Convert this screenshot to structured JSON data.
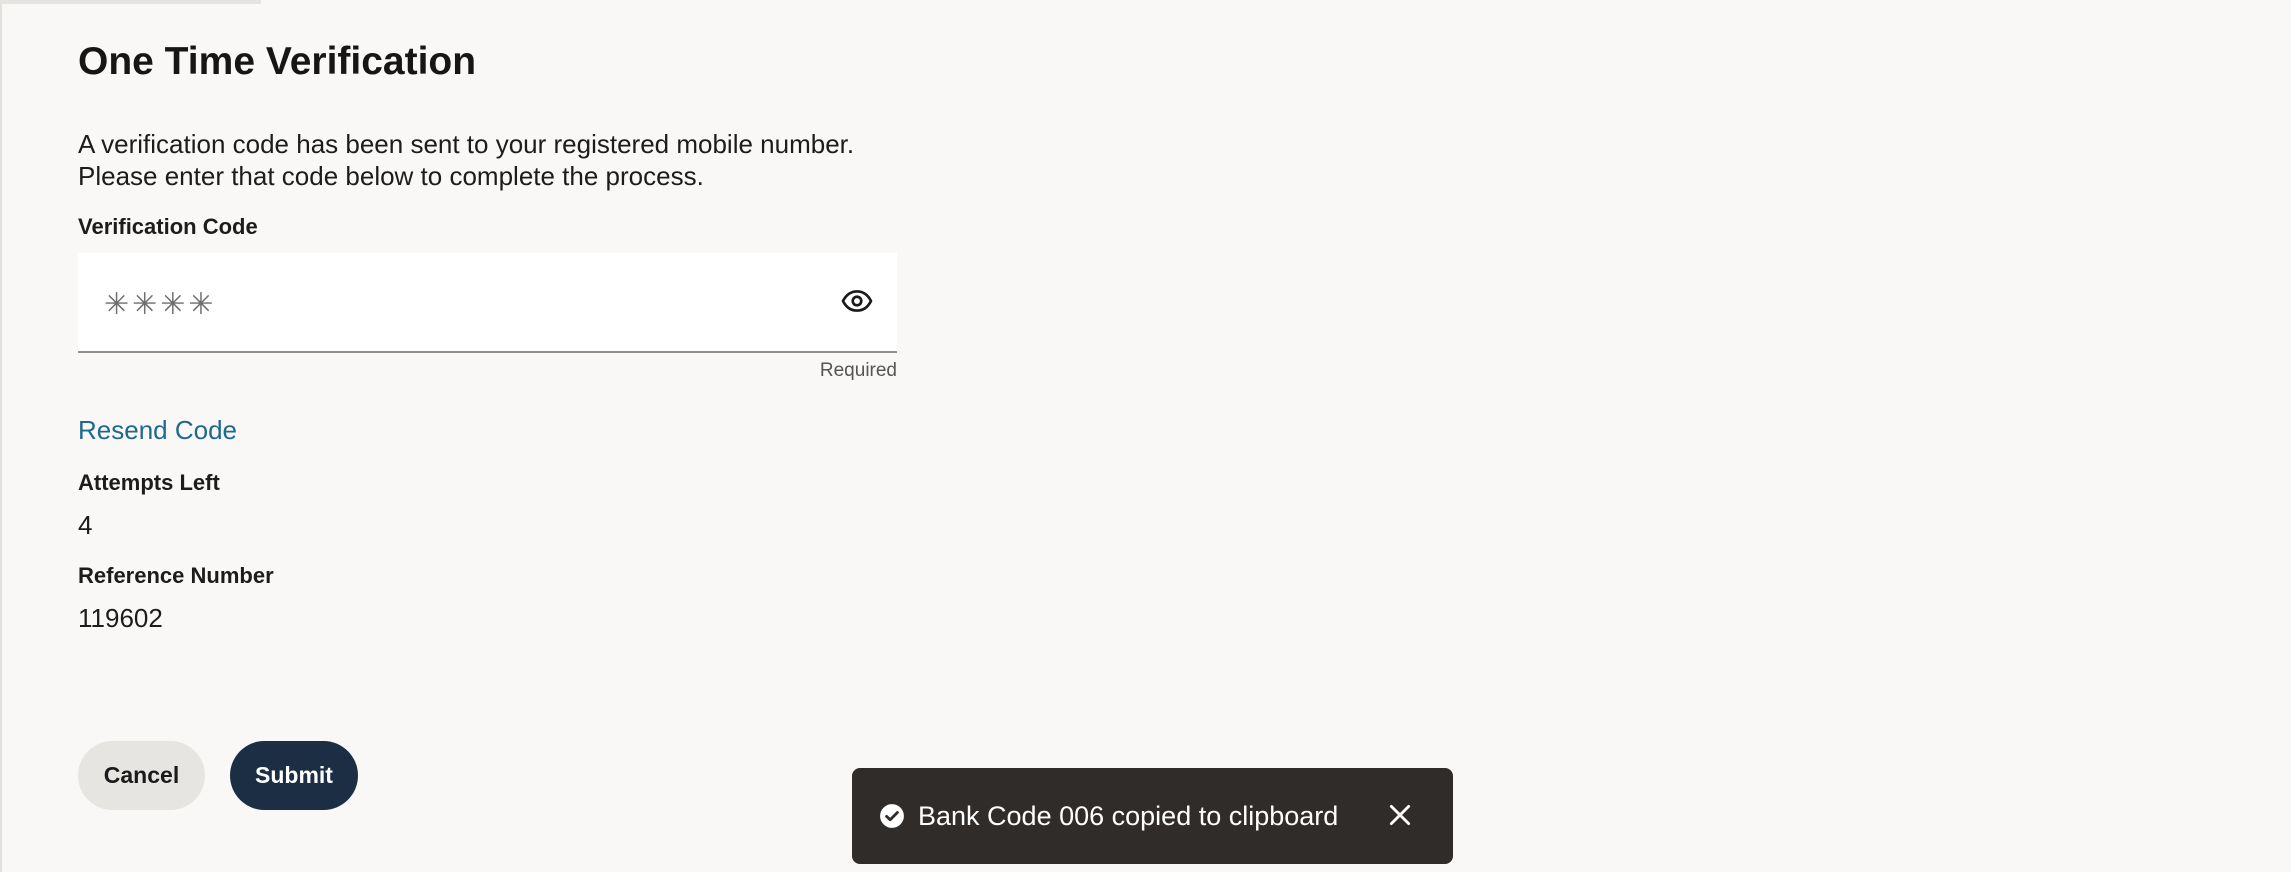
{
  "page": {
    "title": "One Time Verification",
    "description": "A verification code has been sent to your registered mobile number. Please enter that code below to complete the process.",
    "loading_progress_percent": 11.4
  },
  "verification": {
    "label": "Verification Code",
    "placeholder": "✳✳✳✳",
    "value": "",
    "helper_text": "Required",
    "visibility_icon": "eye-icon"
  },
  "resend": {
    "label": "Resend Code"
  },
  "attempts": {
    "label": "Attempts Left",
    "value": "4"
  },
  "reference": {
    "label": "Reference Number",
    "value": "119602"
  },
  "actions": {
    "cancel_label": "Cancel",
    "submit_label": "Submit"
  },
  "toast": {
    "message": "Bank Code 006 copied to clipboard",
    "status_icon": "check-circle-icon",
    "close_icon": "close-icon"
  },
  "colors": {
    "background": "#f9f8f6",
    "link": "#1e6a8c",
    "primary_button": "#1c2e44",
    "secondary_button": "#e6e5e2",
    "toast_background": "#2f2c29"
  }
}
